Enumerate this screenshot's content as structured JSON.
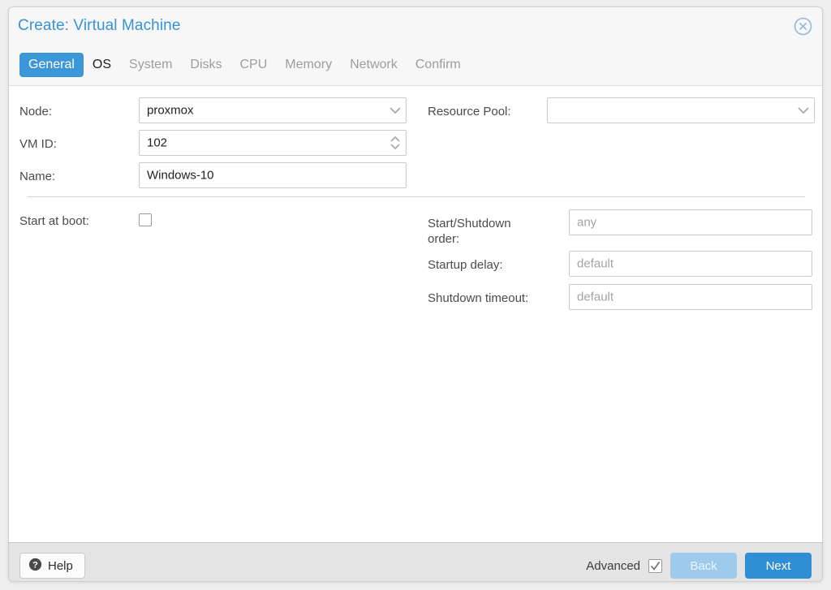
{
  "window": {
    "title": "Create: Virtual Machine",
    "close_icon": "close-circle-icon"
  },
  "tabs": [
    {
      "label": "General",
      "state": "active"
    },
    {
      "label": "OS",
      "state": "enabled"
    },
    {
      "label": "System",
      "state": "disabled"
    },
    {
      "label": "Disks",
      "state": "disabled"
    },
    {
      "label": "CPU",
      "state": "disabled"
    },
    {
      "label": "Memory",
      "state": "disabled"
    },
    {
      "label": "Network",
      "state": "disabled"
    },
    {
      "label": "Confirm",
      "state": "disabled"
    }
  ],
  "form": {
    "node": {
      "label": "Node:",
      "value": "proxmox",
      "trigger_icon": "chevron-down-icon"
    },
    "vmid": {
      "label": "VM ID:",
      "value": "102",
      "trigger_icon": "spinner-updown-icon"
    },
    "name": {
      "label": "Name:",
      "value": "Windows-10"
    },
    "resource_pool": {
      "label": "Resource Pool:",
      "value": "",
      "trigger_icon": "chevron-down-icon"
    },
    "start_at_boot": {
      "label": "Start at boot:",
      "checked": false
    },
    "start_shutdown_order": {
      "label": "Start/Shutdown\norder:",
      "placeholder": "any",
      "value": ""
    },
    "startup_delay": {
      "label": "Startup delay:",
      "placeholder": "default",
      "value": ""
    },
    "shutdown_timeout": {
      "label": "Shutdown timeout:",
      "placeholder": "default",
      "value": ""
    }
  },
  "footer": {
    "help_label": "Help",
    "help_icon": "question-circle-icon",
    "advanced_label": "Advanced",
    "advanced_checked": true,
    "back_label": "Back",
    "next_label": "Next"
  },
  "colors": {
    "accent": "#3c97d8",
    "title": "#3892d4",
    "primary_button": "#2f8fd4",
    "disabled_button": "#9ecbec"
  }
}
